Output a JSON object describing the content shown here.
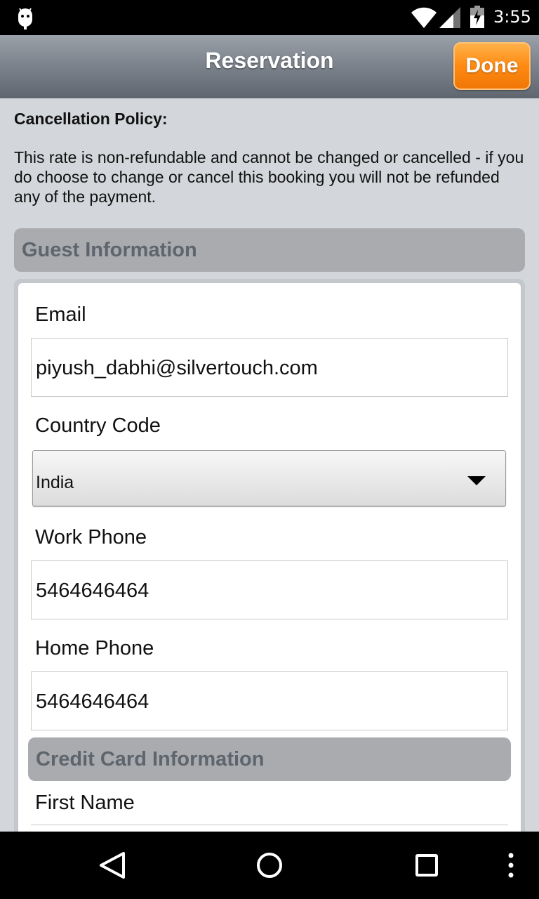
{
  "status_bar": {
    "time": "3:55",
    "icons": [
      "android-debug-icon",
      "wifi-icon",
      "signal-icon",
      "battery-charging-icon"
    ]
  },
  "app_bar": {
    "title": "Reservation",
    "done_label": "Done",
    "done_color": "#ff8a12"
  },
  "policy": {
    "heading": "Cancellation Policy:",
    "text": "This rate is non-refundable and cannot be changed or cancelled - if you do choose to change or cancel this booking you will not be refunded any of the payment."
  },
  "guest_info": {
    "header": "Guest Information",
    "email": {
      "label": "Email",
      "value": "piyush_dabhi@silvertouch.com"
    },
    "country_code": {
      "label": "Country Code",
      "selected": "India"
    },
    "work_phone": {
      "label": "Work Phone",
      "value": "5464646464"
    },
    "home_phone": {
      "label": "Home Phone",
      "value": "5464646464"
    }
  },
  "credit_card": {
    "header": "Credit Card Information",
    "first_name": {
      "label": "First Name",
      "value": ""
    }
  },
  "nav_bar": {
    "icons": [
      "back-icon",
      "home-icon",
      "recents-icon",
      "overflow-menu-icon"
    ]
  }
}
